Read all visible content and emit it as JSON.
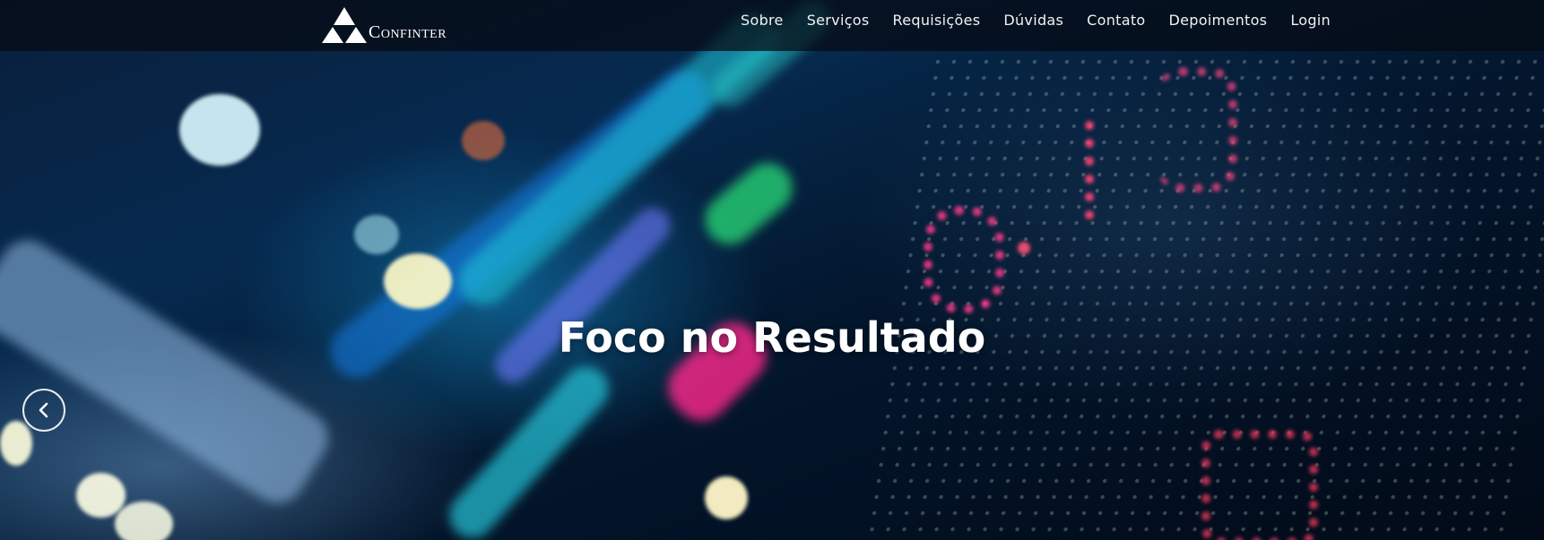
{
  "brand": {
    "name": "Confinter",
    "logo_icon": "mountain-triangles-icon"
  },
  "nav": {
    "items": [
      {
        "label": "Sobre"
      },
      {
        "label": "Serviços"
      },
      {
        "label": "Requisições"
      },
      {
        "label": "Dúvidas"
      },
      {
        "label": "Contato"
      },
      {
        "label": "Depoimentos"
      },
      {
        "label": "Login"
      }
    ]
  },
  "hero": {
    "headline": "Foco no Resultado",
    "prev_icon": "chevron-left-icon"
  },
  "colors": {
    "navbar_bg": "#050a12",
    "text": "#ffffff",
    "accent_pink": "#ff2d8f",
    "accent_cyan": "#35e0e6",
    "accent_green": "#2bd96b"
  }
}
